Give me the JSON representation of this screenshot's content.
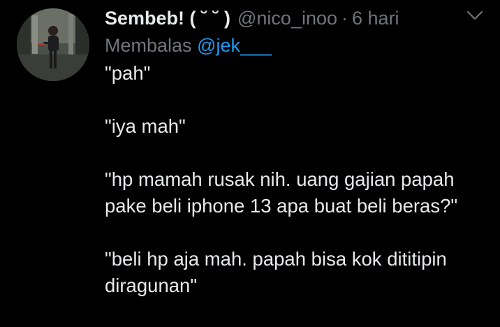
{
  "tweet": {
    "display_name": "Sembeb! ( ˘ ˘ )",
    "handle": "@nico_inoo",
    "separator": "·",
    "time": "6 hari",
    "replying_prefix": "Membalas ",
    "replying_to": "@jek___",
    "paragraphs": [
      "\"pah\"",
      "\"iya mah\"",
      "\"hp mamah rusak nih. uang gajian papah pake beli iphone 13 apa buat beli beras?\"",
      "\"beli hp aja mah. papah bisa kok dititipin diragunan\""
    ],
    "icons": {
      "avatar": "profile-photo",
      "menu": "chevron-down-icon"
    },
    "colors": {
      "background": "#000000",
      "text": "#e7e9ea",
      "muted": "#71767b",
      "accent": "#1d9bf0"
    }
  }
}
